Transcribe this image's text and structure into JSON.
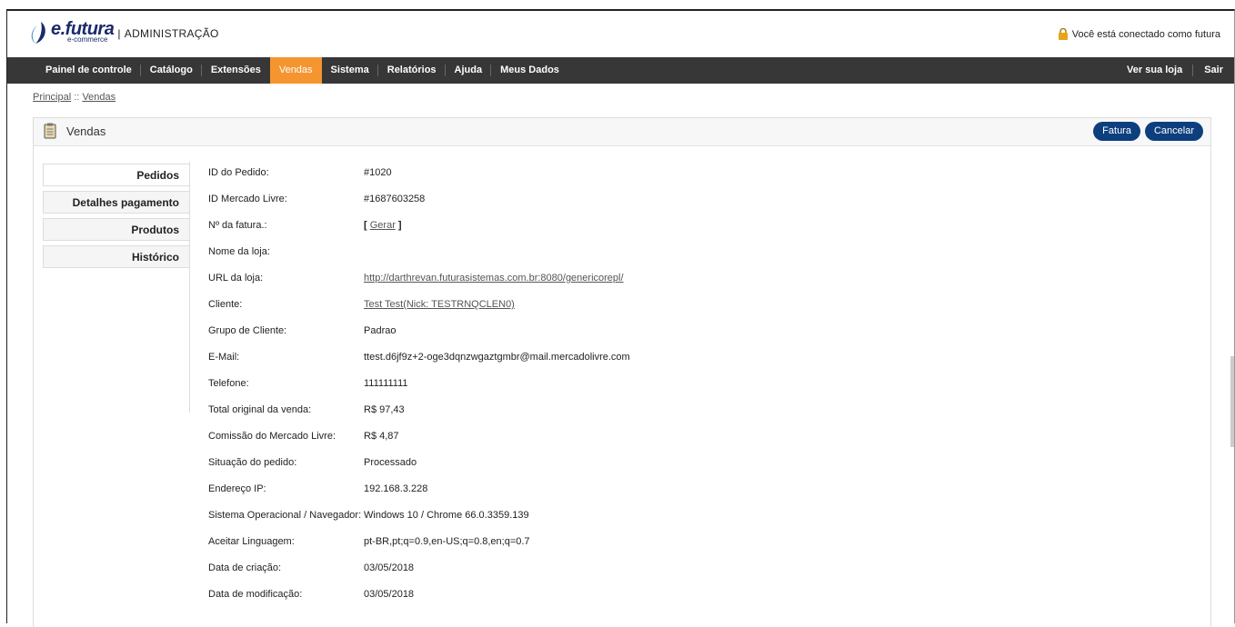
{
  "header": {
    "brand_name": "e.futura",
    "brand_sub": "e-commerce",
    "brand_section": "ADMINISTRAÇÃO",
    "connected_text": "Você está conectado como futura"
  },
  "menu": {
    "items": [
      "Painel de controle",
      "Catálogo",
      "Extensões",
      "Vendas",
      "Sistema",
      "Relatórios",
      "Ajuda",
      "Meus Dados"
    ],
    "active": "Vendas",
    "right_items": [
      "Ver sua loja",
      "Sair"
    ]
  },
  "breadcrumb": {
    "home": "Principal",
    "separator": "::",
    "current": "Vendas"
  },
  "panel": {
    "title": "Vendas",
    "buttons": {
      "invoice": "Fatura",
      "cancel": "Cancelar"
    }
  },
  "tabs": [
    "Pedidos",
    "Detalhes pagamento",
    "Produtos",
    "Histórico"
  ],
  "order": {
    "rows": [
      {
        "label": "ID do Pedido:",
        "value": "#1020"
      },
      {
        "label": "ID Mercado Livre:",
        "value": "#1687603258"
      },
      {
        "label": "Nº da fatura.:",
        "value_prefix": "[",
        "value_link": "Gerar",
        "value_suffix": "]"
      },
      {
        "label": "Nome da loja:",
        "value": ""
      },
      {
        "label": "URL da loja:",
        "value_link": "http://darthrevan.futurasistemas.com.br:8080/genericorepl/"
      },
      {
        "label": "Cliente:",
        "value_link": "Test Test(Nick: TESTRNQCLEN0)"
      },
      {
        "label": "Grupo de Cliente:",
        "value": "Padrao"
      },
      {
        "label": "E-Mail:",
        "value": "ttest.d6jf9z+2-oge3dqnzwgaztgmbr@mail.mercadolivre.com"
      },
      {
        "label": "Telefone:",
        "value": "111111111"
      },
      {
        "label": "Total original da venda:",
        "value": "R$ 97,43"
      },
      {
        "label": "Comissão do Mercado Livre:",
        "value": "R$ 4,87"
      },
      {
        "label": "Situação do pedido:",
        "value": "Processado"
      },
      {
        "label": "Endereço IP:",
        "value": "192.168.3.228"
      },
      {
        "label": "Sistema Operacional / Navegador:",
        "value": "Windows 10 / Chrome 66.0.3359.139"
      },
      {
        "label": "Aceitar Linguagem:",
        "value": "pt-BR,pt;q=0.9,en-US;q=0.8,en;q=0.7"
      },
      {
        "label": "Data de criação:",
        "value": "03/05/2018"
      },
      {
        "label": "Data de modificação:",
        "value": "03/05/2018"
      }
    ]
  },
  "colors": {
    "menu_bg": "#373737",
    "menu_active": "#f49530",
    "button_bg": "#0d3f7f",
    "brand": "#1a2a6c"
  }
}
